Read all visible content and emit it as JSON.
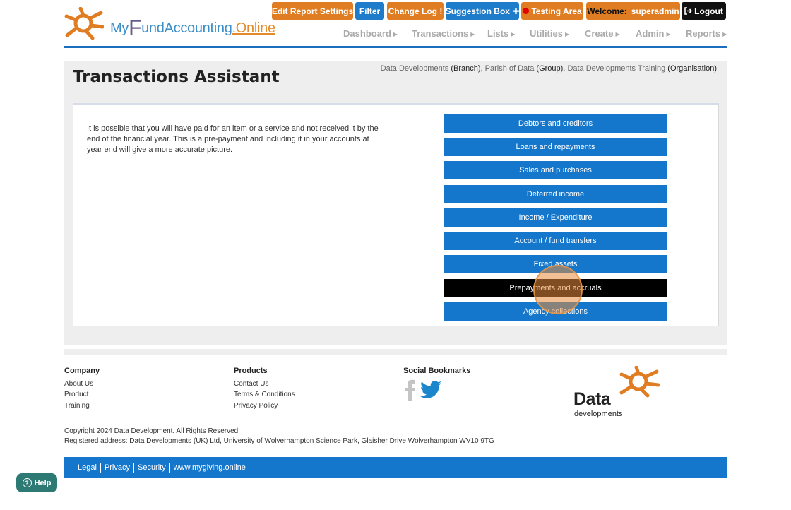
{
  "header": {
    "logo_text_pre": "My",
    "logo_text_f": "F",
    "logo_text_mid": "und",
    "logo_text_main": "Accounting",
    "logo_text_suffix": ".Online",
    "buttons": {
      "edit_report_settings": "Edit Report Settings",
      "filter": "Filter",
      "change_log": "Change Log",
      "change_log_mark": "!",
      "suggestion_box": "Suggestion Box",
      "suggestion_mark": "✚",
      "testing_area": "Testing Area",
      "welcome_label": "Welcome:",
      "welcome_user": "superadmin",
      "logout": "Logout"
    },
    "nav": [
      "Dashboard",
      "Transactions",
      "Lists",
      "Utilities",
      "Create",
      "Admin",
      "Reports"
    ],
    "colors": {
      "orange": "#e07d22",
      "blue": "#1f7ccb",
      "rule": "#1a6fbf"
    }
  },
  "main": {
    "title": "Transactions Assistant",
    "breadcrumb": {
      "branch_name": "Data Developments",
      "branch_type": "(Branch)",
      "group_name": "Parish of Data",
      "group_type": "(Group)",
      "org_name": "Data Developments Training",
      "org_type": "(Organisation)",
      "separator": ","
    },
    "description": "It is possible that you will have paid for an item or a service and not received it by the end of the financial year. This is a pre-payment and including it in your accounts at year end will give a more accurate picture.",
    "actions": [
      "Debtors and creditors",
      "Loans and repayments",
      "Sales and purchases",
      "Deferred income",
      "Income / Expenditure",
      "Account / fund transfers",
      "Fixed assets",
      "Prepayments and accruals",
      "Agency collections"
    ],
    "active_action": "Prepayments and accruals"
  },
  "footer": {
    "company": {
      "heading": "Company",
      "links": [
        "About Us",
        "Product",
        "Training"
      ]
    },
    "products": {
      "heading": "Products",
      "links": [
        "Contact Us",
        "Terms & Conditions",
        "Privacy Policy"
      ]
    },
    "social": {
      "heading": "Social Bookmarks",
      "icons": [
        "facebook-icon",
        "twitter-icon"
      ]
    },
    "brand": {
      "word": "Data",
      "sub": "developments"
    },
    "copyright": "Copyright 2024 Data Development. All Rights Reserved",
    "address": "Registered address: Data Developments (UK) Ltd, University of Wolverhampton Science Park, Glaisher Drive Wolverhampton WV10 9TG",
    "bottom_links": [
      "Legal",
      "Privacy",
      "Security",
      "www.mygiving.online"
    ]
  },
  "help": {
    "label": "Help"
  }
}
